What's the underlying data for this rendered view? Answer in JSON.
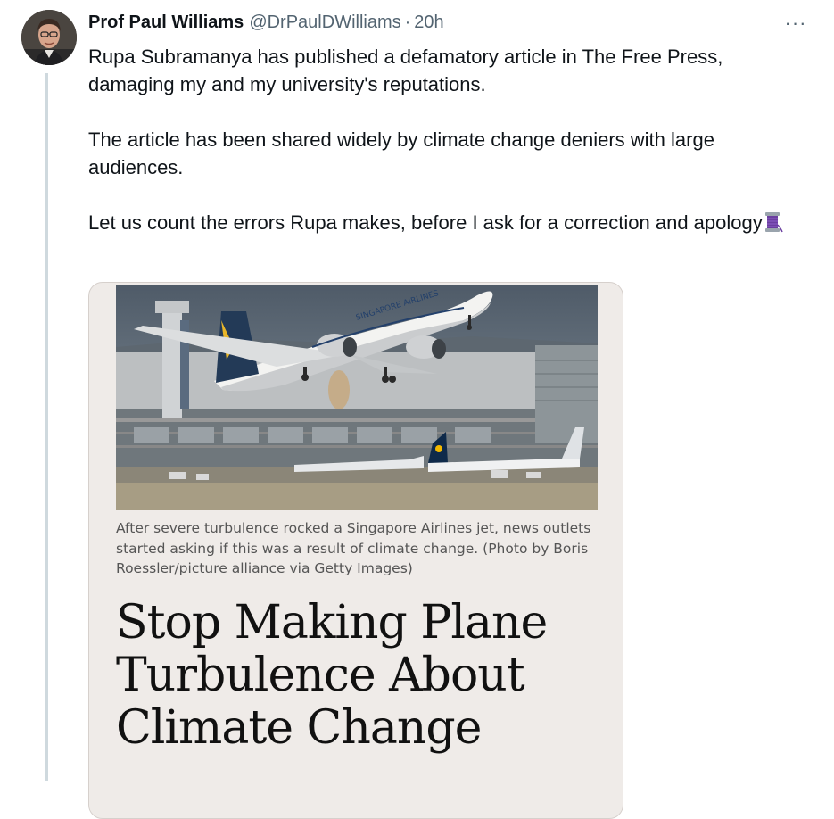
{
  "tweet": {
    "author_name": "Prof Paul Williams",
    "author_handle": "@DrPaulDWilliams",
    "separator": "·",
    "time": "20h",
    "more_icon": "more-horizontal-icon",
    "more_label": "···",
    "paragraphs": [
      "Rupa Subramanya has published a defamatory article in The Free Press, damaging my and my university's reputations.",
      "The article has been shared widely by climate change deniers with large audiences.",
      "Let us count the errors Rupa makes, before I ask for a correction and apology"
    ],
    "thread_emoji": "spool-of-thread-icon"
  },
  "card": {
    "image_caption": "After severe turbulence rocked a Singapore Airlines jet, news outlets started asking if this was a result of climate change. (Photo by Boris Roessler/picture alliance via Getty Images)",
    "headline": "Stop Making Plane Turbulence About Climate Change",
    "plane_livery_text": "SINGAPORE AIRLINES"
  },
  "colors": {
    "text": "#0f1419",
    "secondary": "#536471",
    "thread_line": "#cfd9de",
    "card_bg": "#efebe8"
  }
}
